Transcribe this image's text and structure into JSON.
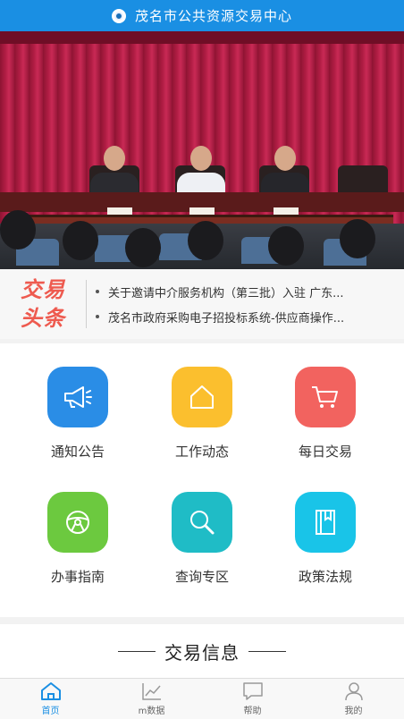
{
  "header": {
    "title": "茂名市公共资源交易中心",
    "logo": "emblem-icon"
  },
  "banner": {
    "image": "meeting-photo"
  },
  "ticker": {
    "badge_line1": "交易",
    "badge_line2": "头条",
    "items": [
      {
        "text": "关于邀请中介服务机构（第三批）入驻 广东..."
      },
      {
        "text": "茂名市政府采购电子招投标系统-供应商操作..."
      }
    ]
  },
  "grid": {
    "items": [
      {
        "label": "通知公告",
        "icon": "megaphone-icon",
        "color": "#2a8de6"
      },
      {
        "label": "工作动态",
        "icon": "house-icon",
        "color": "#fbbf2e"
      },
      {
        "label": "每日交易",
        "icon": "cart-icon",
        "color": "#f2635f"
      },
      {
        "label": "办事指南",
        "icon": "steering-wheel-icon",
        "color": "#6cc93f"
      },
      {
        "label": "查询专区",
        "icon": "magnifier-icon",
        "color": "#1fbcc6"
      },
      {
        "label": "政策法规",
        "icon": "book-icon",
        "color": "#19c4e8"
      }
    ]
  },
  "section": {
    "heading": "交易信息"
  },
  "tabbar": {
    "items": [
      {
        "label": "首页",
        "icon": "home-icon",
        "active": true
      },
      {
        "label": "m数据",
        "icon": "chart-icon",
        "active": false
      },
      {
        "label": "帮助",
        "icon": "chat-icon",
        "active": false
      },
      {
        "label": "我的",
        "icon": "user-icon",
        "active": false
      }
    ]
  },
  "colors": {
    "primary": "#1a8fe3",
    "badge": "#ee5a4f"
  }
}
